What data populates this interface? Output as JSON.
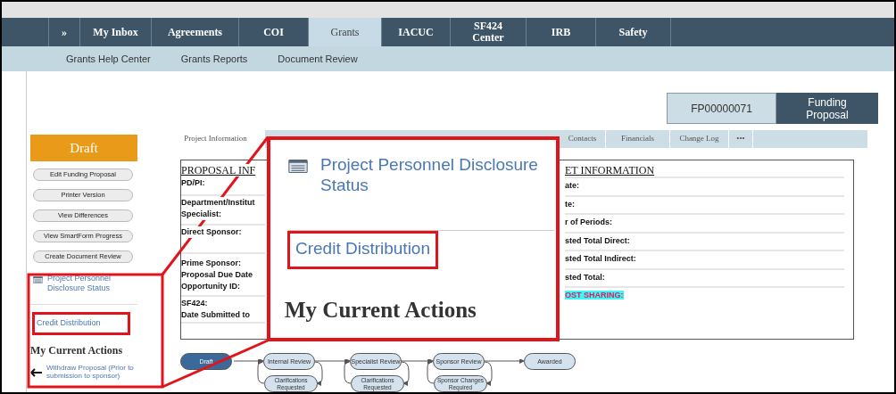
{
  "nav": {
    "tabs": [
      {
        "label": "»",
        "selected": false
      },
      {
        "label": "My Inbox",
        "selected": false
      },
      {
        "label": "Agreements",
        "selected": false
      },
      {
        "label": "COI",
        "selected": false
      },
      {
        "label": "Grants",
        "selected": true
      },
      {
        "label": "IACUC",
        "selected": false
      },
      {
        "label": "SF424 Center",
        "selected": false
      },
      {
        "label": "IRB",
        "selected": false
      },
      {
        "label": "Safety",
        "selected": false
      }
    ]
  },
  "subnav": [
    "Grants Help Center",
    "Grants Reports",
    "Document Review"
  ],
  "record": {
    "id": "FP00000071",
    "type": "Funding Proposal"
  },
  "state": "Draft",
  "actions": [
    "Edit Funding Proposal",
    "Printer Version",
    "View Differences",
    "View SmartForm Progress",
    "Create Document Review"
  ],
  "links": [
    {
      "label": "Project Personnel Disclosure Status",
      "kind": "with-icon",
      "highlighted": false
    },
    {
      "label": "Credit Distribution",
      "kind": "plain",
      "highlighted": true
    }
  ],
  "current_actions": {
    "title": "My Current Actions",
    "items": [
      "Withdraw Proposal (Prior to submission to sponsor)"
    ]
  },
  "tabs": [
    {
      "label": "Project Information",
      "selected": true
    },
    {
      "label": "Contacts",
      "selected": false
    },
    {
      "label": "Financials",
      "selected": false
    },
    {
      "label": "Change Log",
      "selected": false
    },
    {
      "label": "•••",
      "selected": false
    }
  ],
  "proposal_info": {
    "title": "PROPOSAL INF",
    "groups": [
      [
        "PD/PI:"
      ],
      [
        "Department/Institut",
        "Specialist:"
      ],
      [
        "Direct Sponsor:"
      ],
      [
        "Prime Sponsor:",
        "Proposal Due Date",
        "Opportunity ID:"
      ],
      [
        "SF424:",
        "Date Submitted to"
      ]
    ]
  },
  "budget_info": {
    "title": "ET INFORMATION",
    "fields": [
      {
        "label": "ate:",
        "kind": "plain"
      },
      {
        "label": "te:",
        "kind": "plain"
      },
      {
        "label": "r of Periods:",
        "kind": "plain"
      },
      {
        "label": "sted Total Direct:",
        "kind": "plain"
      },
      {
        "label": "sted Total Indirect:",
        "kind": "plain"
      },
      {
        "label": "sted Total:",
        "kind": "plain"
      },
      {
        "label": "OST SHARING:",
        "kind": "highlight"
      }
    ]
  },
  "callout": {
    "links": [
      {
        "label": "Project Personnel Disclosure Status",
        "kind": "with-icon",
        "highlighted": false
      },
      {
        "label": "Credit Distribution",
        "kind": "plain",
        "highlighted": true
      }
    ],
    "heading": "My Current Actions"
  },
  "workflow": {
    "steps": [
      {
        "label": "Draft",
        "current": true
      },
      {
        "label": "Internal Review",
        "current": false,
        "loop": "Clarifications Requested"
      },
      {
        "label": "Specialist Review",
        "current": false,
        "loop": "Clarifications Requested"
      },
      {
        "label": "Sponsor Review",
        "current": false,
        "loop": "Sponsor Changes Required"
      },
      {
        "label": "Awarded",
        "current": false
      }
    ]
  }
}
